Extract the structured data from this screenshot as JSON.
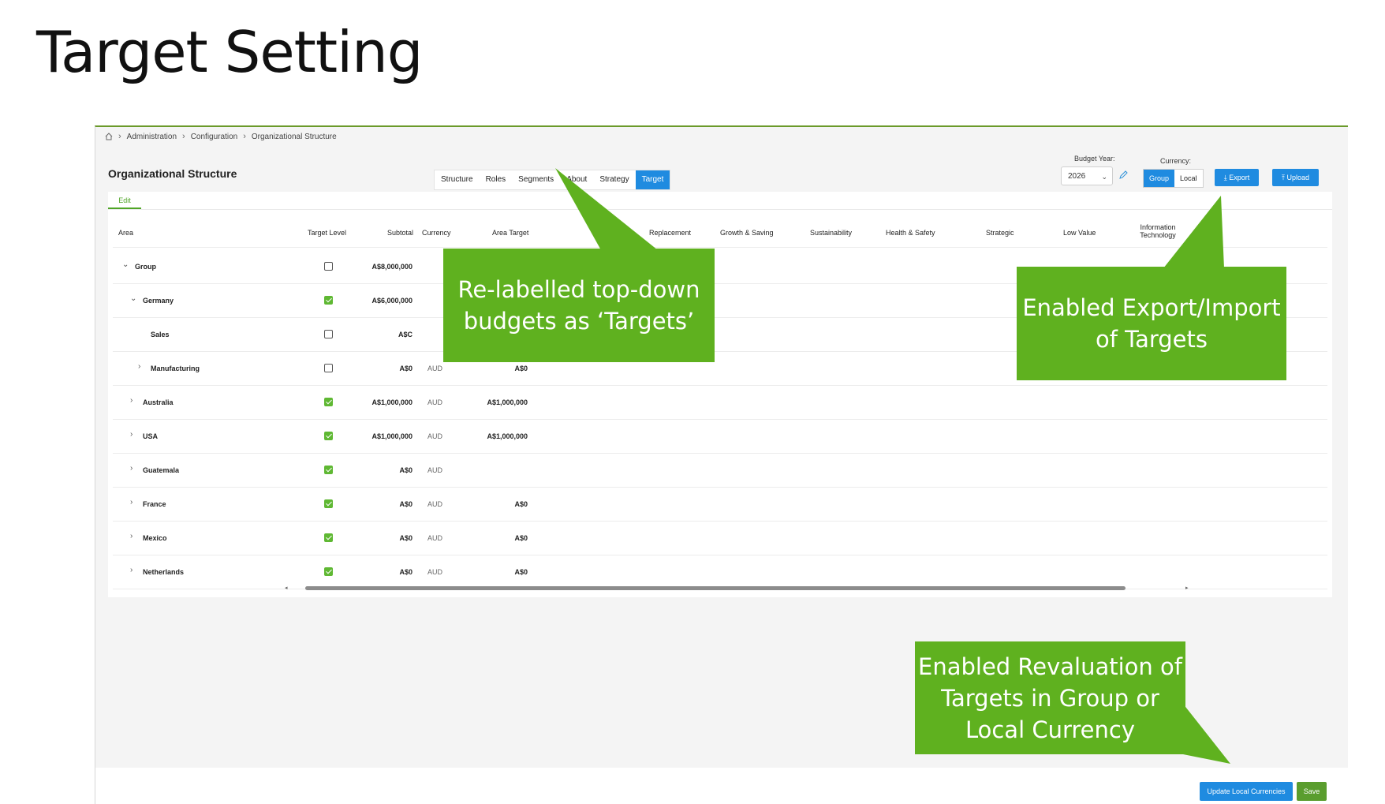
{
  "slide": {
    "title": "Target Setting"
  },
  "breadcrumb": {
    "items": [
      "Administration",
      "Configuration",
      "Organizational Structure"
    ]
  },
  "page": {
    "title": "Organizational Structure"
  },
  "tabs": [
    "Structure",
    "Roles",
    "Segments",
    "About",
    "Strategy",
    "Target"
  ],
  "active_tab": "Target",
  "budget_year": {
    "label": "Budget Year:",
    "value": "2026"
  },
  "currency": {
    "label": "Currency:",
    "options": [
      "Group",
      "Local"
    ],
    "selected": "Group"
  },
  "buttons": {
    "export": "Export",
    "upload": "Upload",
    "update_local": "Update Local Currencies",
    "save": "Save"
  },
  "edit_tab": "Edit",
  "columns": {
    "area": "Area",
    "target_level": "Target Level",
    "subtotal": "Subtotal",
    "currency": "Currency",
    "area_target": "Area Target",
    "replacement": "Replacement",
    "growth_saving": "Growth & Saving",
    "sustainability": "Sustainability",
    "health_safety": "Health & Safety",
    "strategic": "Strategic",
    "low_value": "Low Value",
    "information_technology_1": "Information",
    "information_technology_2": "Technology"
  },
  "rows": [
    {
      "name": "Group",
      "checked": false,
      "subtotal": "A$8,000,000",
      "currency": "",
      "area_target": ""
    },
    {
      "name": "Germany",
      "checked": true,
      "subtotal": "A$6,000,000",
      "currency": "",
      "area_target": ""
    },
    {
      "name": "Sales",
      "checked": false,
      "subtotal": "A$C",
      "currency": "",
      "area_target": ""
    },
    {
      "name": "Manufacturing",
      "checked": false,
      "subtotal": "A$0",
      "currency": "AUD",
      "area_target": "A$0"
    },
    {
      "name": "Australia",
      "checked": true,
      "subtotal": "A$1,000,000",
      "currency": "AUD",
      "area_target": "A$1,000,000"
    },
    {
      "name": "USA",
      "checked": true,
      "subtotal": "A$1,000,000",
      "currency": "AUD",
      "area_target": "A$1,000,000"
    },
    {
      "name": "Guatemala",
      "checked": true,
      "subtotal": "A$0",
      "currency": "AUD",
      "area_target": ""
    },
    {
      "name": "France",
      "checked": true,
      "subtotal": "A$0",
      "currency": "AUD",
      "area_target": "A$0"
    },
    {
      "name": "Mexico",
      "checked": true,
      "subtotal": "A$0",
      "currency": "AUD",
      "area_target": "A$0"
    },
    {
      "name": "Netherlands",
      "checked": true,
      "subtotal": "A$0",
      "currency": "AUD",
      "area_target": "A$0"
    }
  ],
  "callouts": {
    "relabel": [
      "Re-labelled top-down",
      "budgets as ‘Targets’"
    ],
    "export_import": [
      "Enabled Export/Import",
      "of Targets"
    ],
    "revaluation": [
      "Enabled Revaluation of",
      "Targets in Group or",
      "Local Currency"
    ]
  },
  "colors": {
    "accent_blue": "#1f8be0",
    "callout_green": "#5fb11f",
    "check_green": "#5fb833",
    "save_green": "#5a9d2e"
  }
}
